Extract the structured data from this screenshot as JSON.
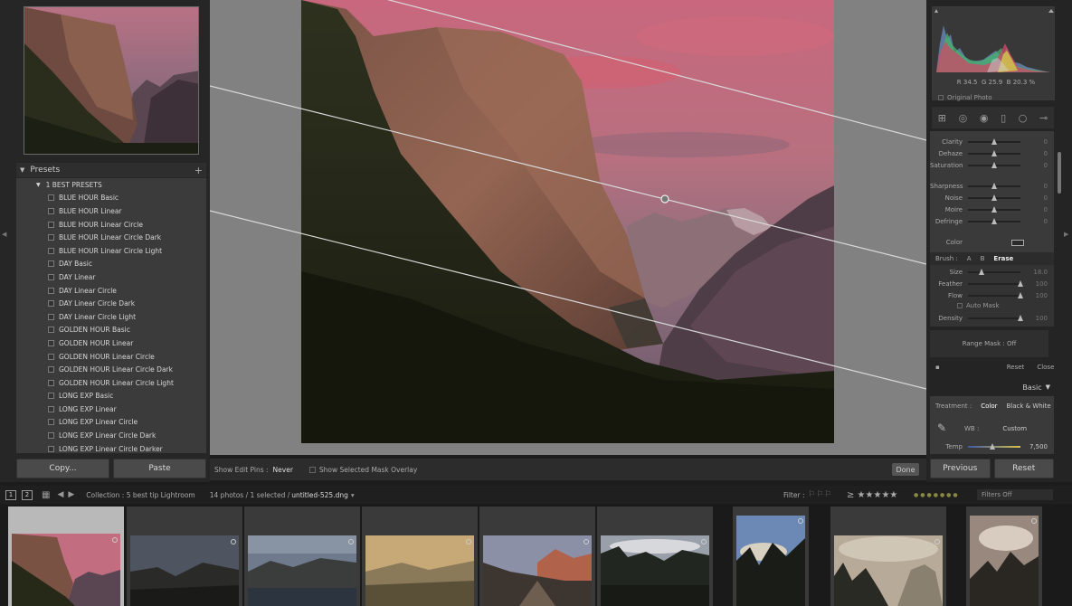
{
  "left_panel": {
    "presets_title": "Presets",
    "add_icon": "+",
    "folder": "1 BEST PRESETS",
    "presets": [
      "BLUE HOUR Basic",
      "BLUE HOUR Linear",
      "BLUE HOUR Linear Circle",
      "BLUE HOUR Linear Circle Dark",
      "BLUE HOUR Linear Circle Light",
      "DAY Basic",
      "DAY Linear",
      "DAY Linear Circle",
      "DAY Linear Circle Dark",
      "DAY Linear Circle Light",
      "GOLDEN HOUR Basic",
      "GOLDEN HOUR Linear",
      "GOLDEN HOUR Linear Circle",
      "GOLDEN HOUR Linear Circle Dark",
      "GOLDEN HOUR Linear Circle Light",
      "LONG EXP Basic",
      "LONG EXP Linear",
      "LONG EXP Linear Circle",
      "LONG EXP Linear Circle Dark",
      "LONG EXP Linear Circle Darker"
    ],
    "copy_label": "Copy...",
    "paste_label": "Paste"
  },
  "toolbar": {
    "pins_label": "Show Edit Pins :",
    "pins_value": "Never",
    "overlay_label": "Show Selected Mask Overlay",
    "done_label": "Done"
  },
  "right_panel": {
    "hist_r_label": "R",
    "hist_r": "34.5",
    "hist_g_label": "G",
    "hist_g": "25.9",
    "hist_b_label": "B",
    "hist_b": "20.3",
    "hist_unit": "%",
    "original_photo": "Original Photo",
    "sliders": [
      {
        "label": "Clarity",
        "value": "0",
        "pos": 0.5
      },
      {
        "label": "Dehaze",
        "value": "0",
        "pos": 0.5
      },
      {
        "label": "Saturation",
        "value": "0",
        "pos": 0.5
      },
      {
        "label": "Sharpness",
        "value": "0",
        "pos": 0.5
      },
      {
        "label": "Noise",
        "value": "0",
        "pos": 0.5
      },
      {
        "label": "Moire",
        "value": "0",
        "pos": 0.5
      },
      {
        "label": "Defringe",
        "value": "0",
        "pos": 0.5
      }
    ],
    "color_label": "Color",
    "brush_label": "Brush :",
    "brush_a": "A",
    "brush_b": "B",
    "brush_erase": "Erase",
    "brush_sliders": [
      {
        "label": "Size",
        "value": "18.0",
        "pos": 0.25
      },
      {
        "label": "Feather",
        "value": "100",
        "pos": 1.0
      },
      {
        "label": "Flow",
        "value": "100",
        "pos": 1.0
      }
    ],
    "auto_mask": "Auto Mask",
    "density": {
      "label": "Density",
      "value": "100",
      "pos": 1.0
    },
    "range_mask_label": "Range Mask :",
    "range_mask_value": "Off",
    "reset_label": "Reset",
    "close_label": "Close",
    "basic_title": "Basic",
    "treatment_label": "Treatment :",
    "treatment_color": "Color",
    "treatment_bw": "Black & White",
    "wb_label": "WB :",
    "wb_value": "Custom",
    "temp_label": "Temp",
    "temp_value": "7,500",
    "previous_label": "Previous",
    "reset_button_label": "Reset"
  },
  "film_bar": {
    "monitor_1": "1",
    "monitor_2": "2",
    "collection": "Collection : 5 best tip Lightroom",
    "count": "14 photos / 1 selected /",
    "filename": "untitled-525.dng",
    "filter_label": "Filter :",
    "filter_stars": "≥ ★★★★★",
    "filters_off": "Filters Off"
  },
  "colors": {
    "panel_bg": "#242424",
    "center_bg": "#818181",
    "sky_pink": "#cf6f82",
    "rock": "#7d5347"
  }
}
